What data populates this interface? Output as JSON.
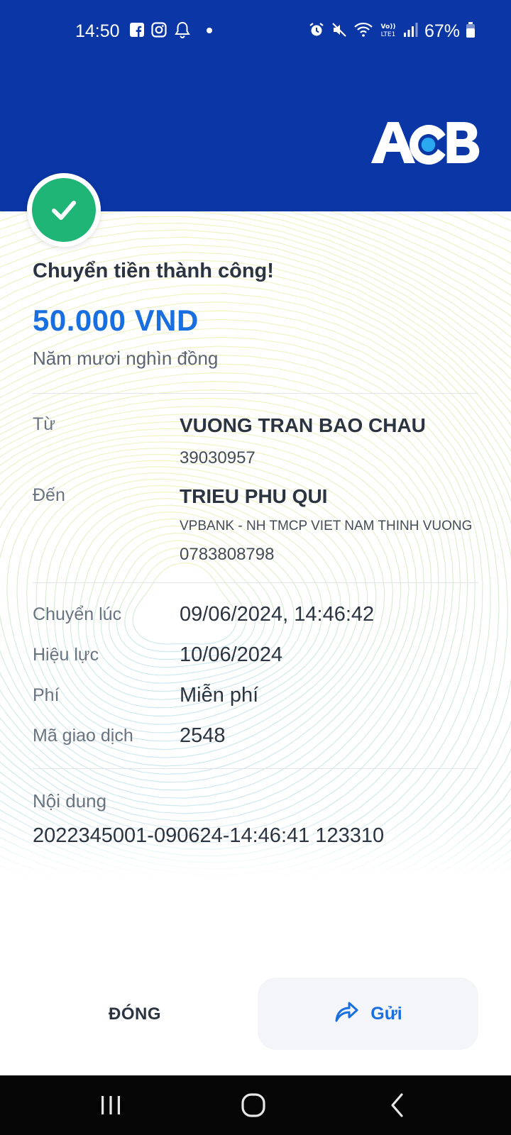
{
  "status_bar": {
    "time": "14:50",
    "battery": "67%",
    "left_icons": [
      "facebook-icon",
      "instagram-icon",
      "notification-bell-icon",
      "dot-icon"
    ],
    "right_icons": [
      "alarm-icon",
      "mute-icon",
      "wifi-icon",
      "volte-icon",
      "signal-icon",
      "battery-icon"
    ]
  },
  "header": {
    "logo_text": "ACB",
    "background_color": "#0a36a6"
  },
  "receipt": {
    "title": "Chuyển tiền thành công!",
    "amount": "50.000 VND",
    "amount_words": "Năm mươi nghìn đồng",
    "from": {
      "label": "Từ",
      "name": "VUONG TRAN BAO CHAU",
      "account": "39030957"
    },
    "to": {
      "label": "Đến",
      "name": "TRIEU PHU QUI",
      "bank": "VPBANK - NH TMCP VIET NAM THINH VUONG",
      "account": "0783808798"
    },
    "details": [
      {
        "label": "Chuyển lúc",
        "value": "09/06/2024, 14:46:42"
      },
      {
        "label": "Hiệu lực",
        "value": "10/06/2024"
      },
      {
        "label": "Phí",
        "value": "Miễn phí"
      },
      {
        "label": "Mã giao dịch",
        "value": "2548"
      }
    ],
    "content": {
      "label": "Nội dung",
      "value": "2022345001-090624-14:46:41 123310"
    }
  },
  "actions": {
    "close_label": "ĐÓNG",
    "send_label": "Gửi"
  },
  "colors": {
    "accent": "#1a6fe0",
    "success": "#1fb577",
    "brand_blue": "#0a36a6"
  }
}
